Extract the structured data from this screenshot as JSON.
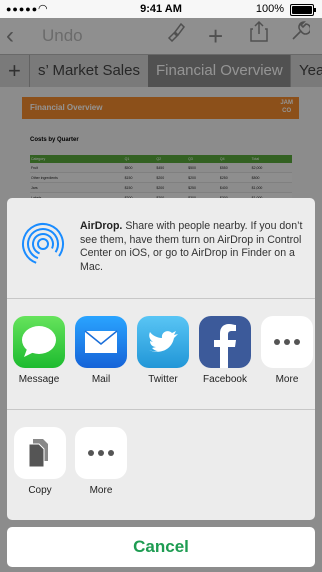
{
  "status": {
    "carrier": "●●●●●",
    "time": "9:41 AM",
    "battery": "100%"
  },
  "toolbar": {
    "undo": "Undo"
  },
  "tabs": {
    "items": [
      {
        "label": "s’ Market Sales"
      },
      {
        "label": "Financial Overview"
      },
      {
        "label": "Year"
      }
    ]
  },
  "sheet": {
    "banner_title": "Financial Overview",
    "logo_line1": "JAM",
    "logo_line2": "CO",
    "section_title": "Costs by Quarter",
    "headers": [
      "Category",
      "Q1",
      "Q2",
      "Q3",
      "Q4",
      "Total"
    ],
    "rows": [
      [
        "Fruit",
        "$500",
        "$450",
        "$500",
        "$550",
        "$2,000"
      ],
      [
        "Other ingredients",
        "$150",
        "$200",
        "$200",
        "$250",
        "$800"
      ],
      [
        "Jars",
        "$150",
        "$200",
        "$250",
        "$400",
        "$1,000"
      ],
      [
        "Labels",
        "$200",
        "$200",
        "$300",
        "$300",
        "$1,000"
      ]
    ]
  },
  "share": {
    "airdrop_title": "AirDrop.",
    "airdrop_body": " Share with people nearby. If you don’t see them, have them turn on AirDrop in Control Center on iOS, or go to AirDrop in Finder on a Mac.",
    "apps": [
      {
        "label": "Message",
        "icon": "message-icon"
      },
      {
        "label": "Mail",
        "icon": "mail-icon"
      },
      {
        "label": "Twitter",
        "icon": "twitter-icon"
      },
      {
        "label": "Facebook",
        "icon": "facebook-icon"
      },
      {
        "label": "More",
        "icon": "more-icon"
      }
    ],
    "actions": [
      {
        "label": "Copy",
        "icon": "copy-icon"
      },
      {
        "label": "More",
        "icon": "more-icon"
      }
    ],
    "cancel": "Cancel"
  },
  "colors": {
    "accent_green": "#1e9c52",
    "banner_orange": "#f28b2d",
    "table_header": "#59a83b"
  }
}
